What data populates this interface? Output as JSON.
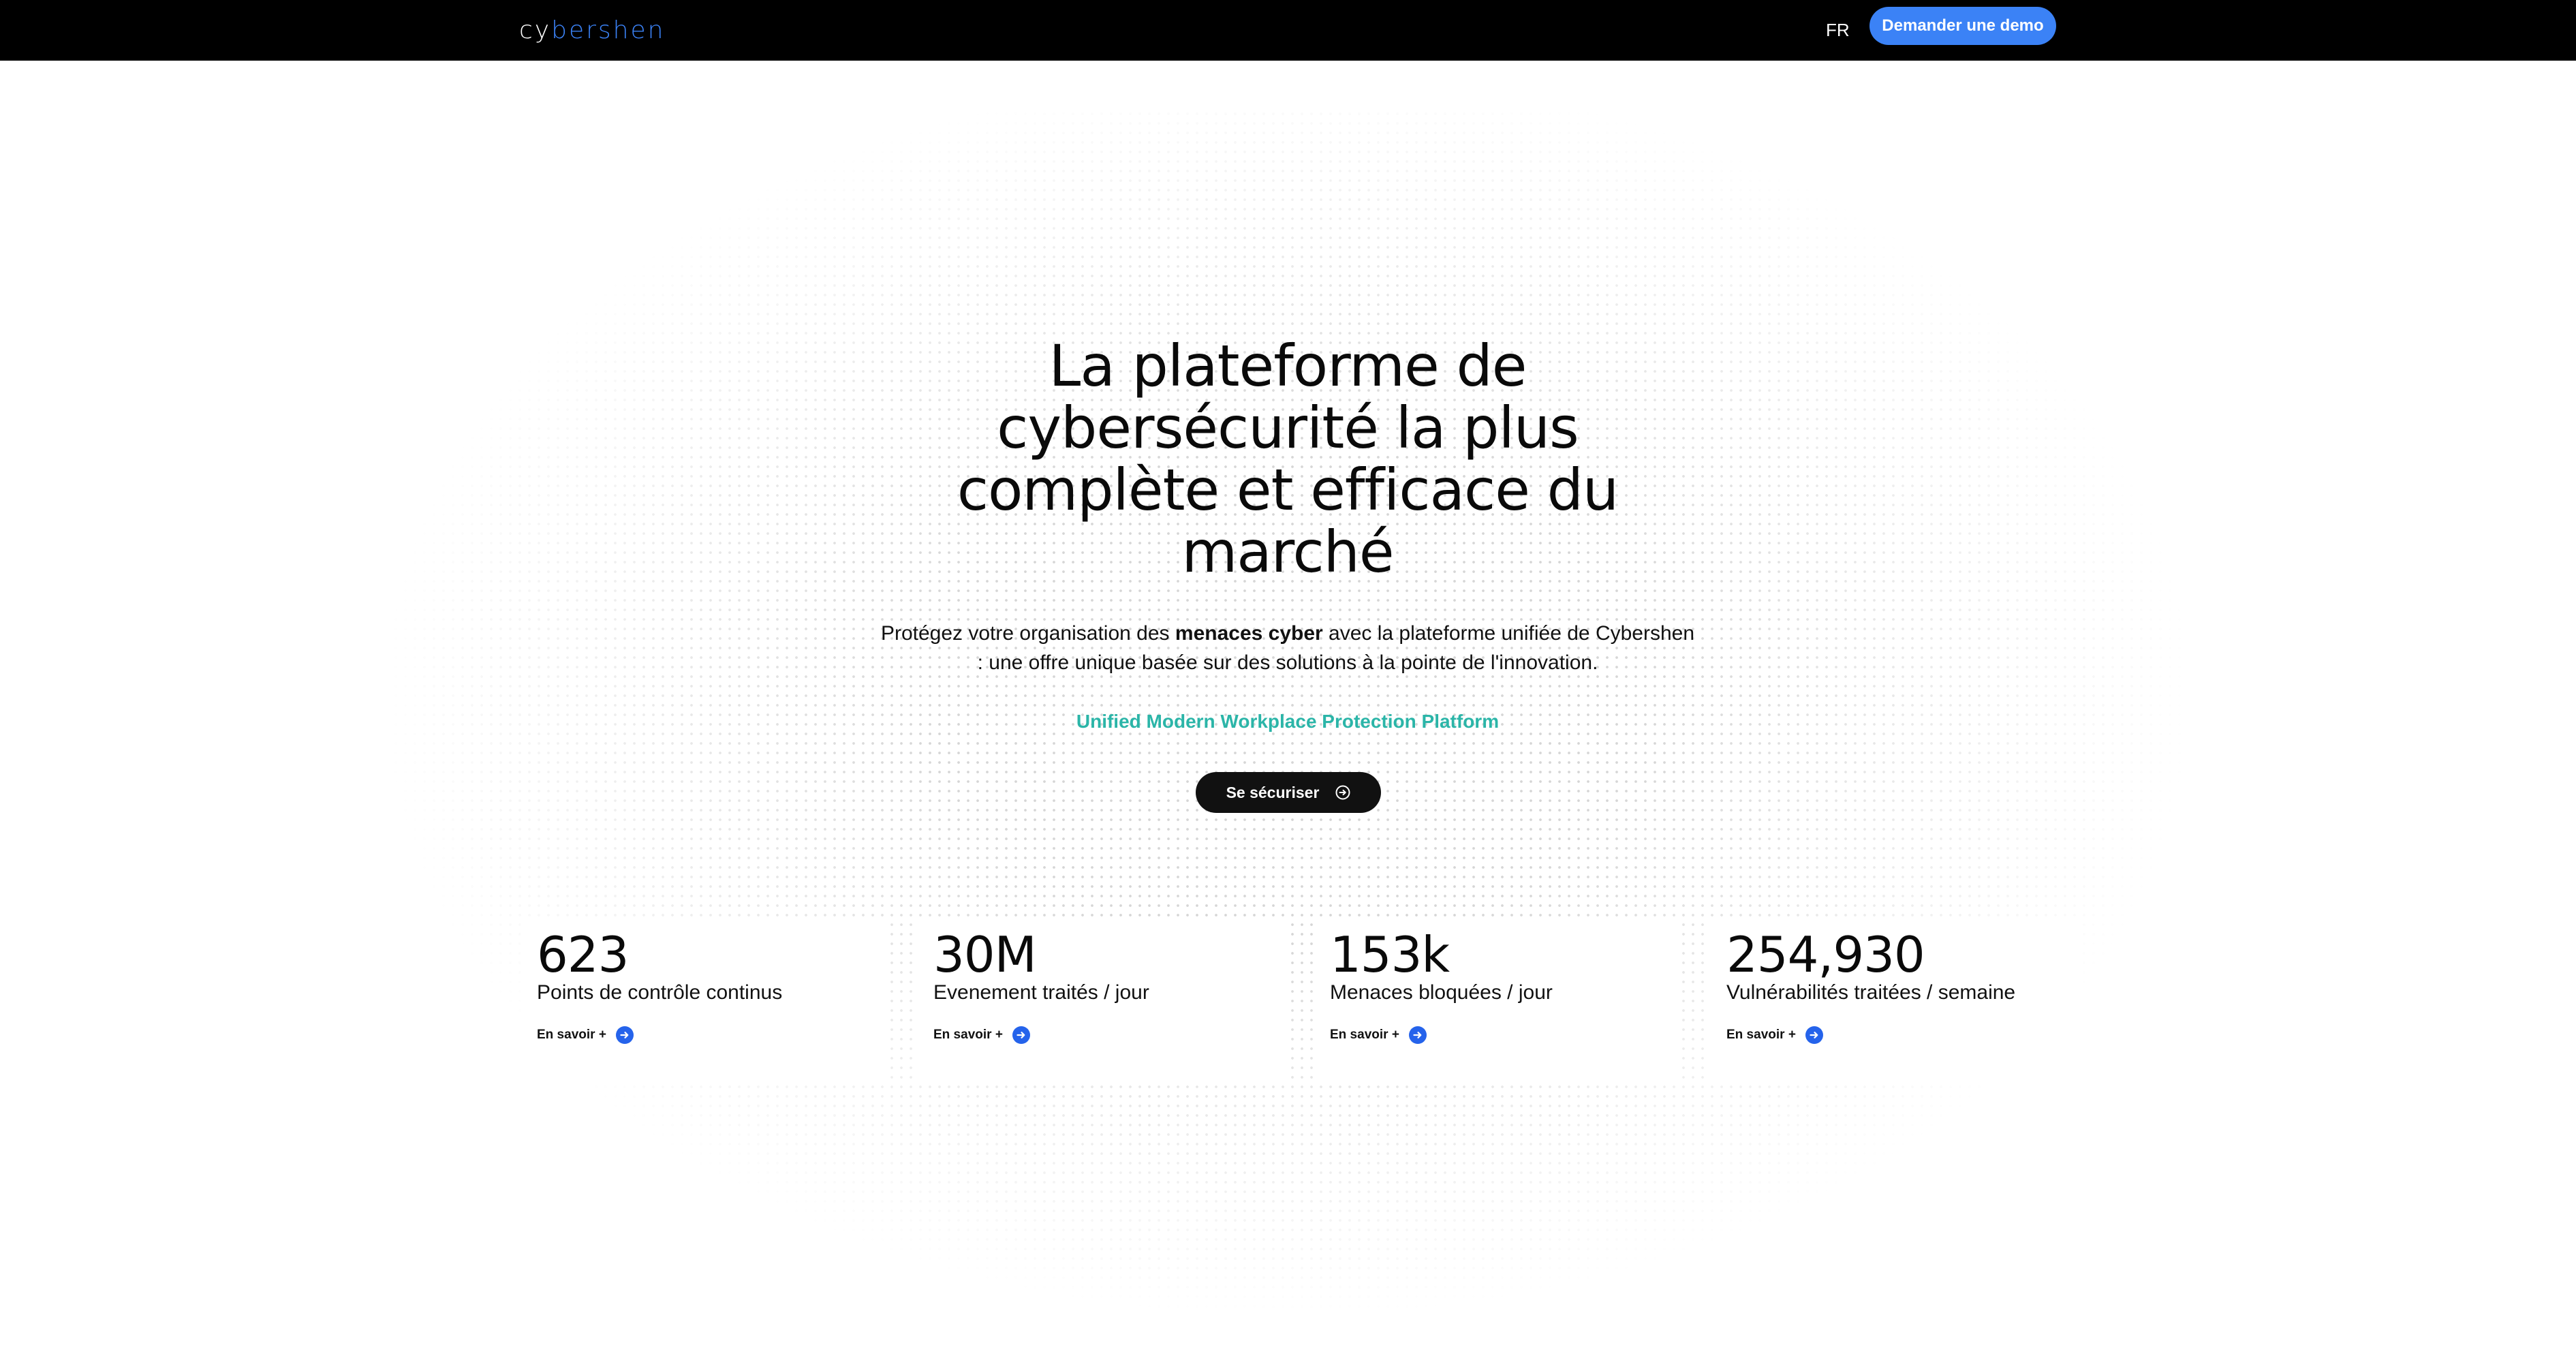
{
  "brand": {
    "logo_part1": "cy",
    "logo_part2": "bershen",
    "accent": "#3b82f6",
    "teal": "#2bb5a8"
  },
  "nav": {
    "language": "FR",
    "demo_button": "Demander une demo"
  },
  "hero": {
    "title": "La plateforme de cybersécurité la plus complète et efficace du marché",
    "subtitle_before": "Protégez votre organisation des ",
    "subtitle_bold": "menaces cyber",
    "subtitle_after": " avec la plateforme unifiée de Cybershen : une offre unique basée sur des solutions à la pointe de l'innovation.",
    "tagline": "Unified Modern Workplace Protection Platform",
    "cta_label": "Se sécuriser",
    "cta_icon": "arrow-circle-right-icon"
  },
  "stats": [
    {
      "value": "623",
      "label": "Points de contrôle continus",
      "link": "En savoir +"
    },
    {
      "value": "30M",
      "label": "Evenement traités / jour",
      "link": "En savoir +"
    },
    {
      "value": "153k",
      "label": "Menaces bloquées / jour",
      "link": "En savoir +"
    },
    {
      "value": "254,930",
      "label": "Vulnérabilités traitées / semaine",
      "link": "En savoir +"
    }
  ]
}
